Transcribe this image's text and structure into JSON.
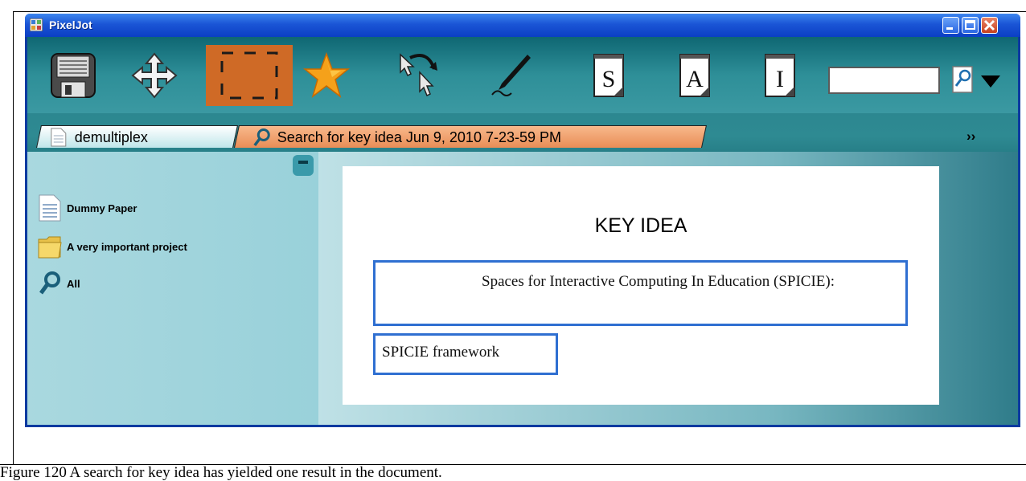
{
  "window": {
    "title": "PixelJot"
  },
  "toolbar": {
    "tools": [
      {
        "icon": "floppy-disk-icon"
      },
      {
        "icon": "move-arrows-icon"
      },
      {
        "icon": "selection-rectangle-icon"
      },
      {
        "icon": "star-icon"
      },
      {
        "icon": "drag-cursor-icon"
      },
      {
        "icon": "pen-icon"
      },
      {
        "icon": "s-note-icon",
        "letter": "S"
      },
      {
        "icon": "a-note-icon",
        "letter": "A"
      },
      {
        "icon": "i-note-icon",
        "letter": "I"
      }
    ],
    "search_value": ""
  },
  "tabs": [
    {
      "label": "demultiplex",
      "icon": "document-icon"
    },
    {
      "label": "Search for key idea Jun 9, 2010 7-23-59 PM",
      "icon": "search-icon"
    }
  ],
  "tabs_overflow": "››",
  "sidebar": {
    "items": [
      {
        "label": "Dummy Paper",
        "icon": "document-icon"
      },
      {
        "label": "A very important project",
        "icon": "folder-icon"
      },
      {
        "label": "All",
        "icon": "search-icon"
      }
    ]
  },
  "page": {
    "title": "KEY IDEA",
    "results": [
      "Spaces for Interactive Computing In Education (SPICIE):",
      "SPICIE framework"
    ]
  },
  "caption": "Figure 120  A search for key idea has yielded one result in the document.",
  "colors": {
    "titlebar": "#1a55d6",
    "toolbar": "#2e8f98",
    "active_tab": "#e98d56",
    "sidebar": "#a9d8df",
    "result_border": "#2f6fd1"
  }
}
